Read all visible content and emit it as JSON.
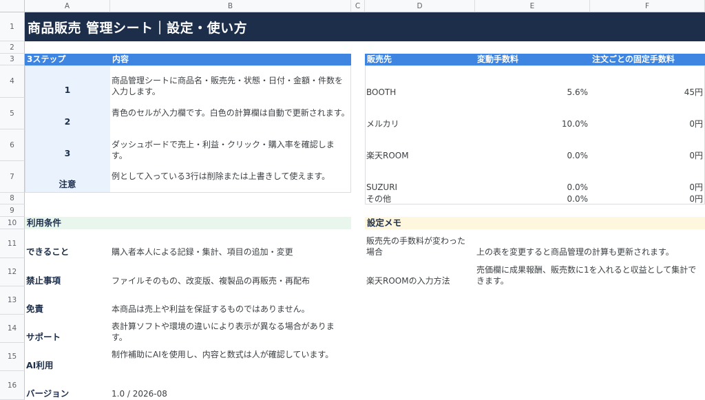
{
  "columns": [
    "A",
    "B",
    "C",
    "D",
    "E",
    "F"
  ],
  "rows": [
    "1",
    "2",
    "3",
    "4",
    "5",
    "6",
    "7",
    "8",
    "9",
    "10",
    "11",
    "12",
    "13",
    "14",
    "15",
    "16"
  ],
  "title": "商品販売 管理シート｜設定・使い方",
  "steps": {
    "header_step": "3ステップ",
    "header_content": "内容",
    "items": [
      {
        "label": "1",
        "text": "商品管理シートに商品名・販売先・状態・日付・金額・件数を入力します。"
      },
      {
        "label": "2",
        "text": "青色のセルが入力欄です。白色の計算欄は自動で更新されます。"
      },
      {
        "label": "3",
        "text": "ダッシュボードで売上・利益・クリック・購入率を確認します。"
      },
      {
        "label": "注意",
        "text": "例として入っている3行は削除または上書きして使えます。"
      }
    ]
  },
  "fees": {
    "header_channel": "販売先",
    "header_rate": "変動手数料",
    "header_fixed": "注文ごとの固定手数料",
    "items": [
      {
        "channel": "BOOTH",
        "rate": "5.6%",
        "fixed": "45円"
      },
      {
        "channel": "メルカリ",
        "rate": "10.0%",
        "fixed": "0円"
      },
      {
        "channel": "楽天ROOM",
        "rate": "0.0%",
        "fixed": "0円"
      },
      {
        "channel": "SUZURI",
        "rate": "0.0%",
        "fixed": "0円"
      },
      {
        "channel": "その他",
        "rate": "0.0%",
        "fixed": "0円"
      }
    ]
  },
  "terms": {
    "header": "利用条件",
    "items": [
      {
        "label": "できること",
        "text": "購入者本人による記録・集計、項目の追加・変更"
      },
      {
        "label": "禁止事項",
        "text": "ファイルそのもの、改変版、複製品の再販売・再配布"
      },
      {
        "label": "免責",
        "text": "本商品は売上や利益を保証するものではありません。"
      },
      {
        "label": "サポート",
        "text": "表計算ソフトや環境の違いにより表示が異なる場合があります。"
      },
      {
        "label": "AI利用",
        "text": "制作補助にAIを使用し、内容と数式は人が確認しています。"
      },
      {
        "label": "バージョン",
        "text": "1.0 / 2026-08"
      }
    ]
  },
  "memo": {
    "header": "設定メモ",
    "items": [
      {
        "label": "販売先の手数料が変わった場合",
        "text": "上の表を変更すると商品管理の計算も更新されます。"
      },
      {
        "label": "楽天ROOMの入力方法",
        "text": "売価欄に成果報酬、販売数に1を入れると収益として集計できます。"
      }
    ]
  }
}
